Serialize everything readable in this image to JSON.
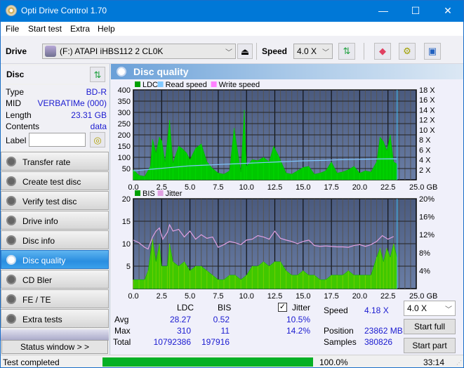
{
  "window": {
    "title": "Opti Drive Control 1.70",
    "minimize": "—",
    "maximize": "☐",
    "close": "✕"
  },
  "menu": [
    "File",
    "Start test",
    "Extra",
    "Help"
  ],
  "toolbar": {
    "drive_label": "Drive",
    "drive_value": "(F:)  ATAPI iHBS112  2 CL0K",
    "speed_label": "Speed",
    "speed_value": "4.0 X",
    "icons": [
      "drive-icon",
      "eject-icon",
      "refresh-icon",
      "eraser-icon",
      "settings-icon",
      "save-icon"
    ]
  },
  "sidebar": {
    "disc_header": "Disc",
    "info": [
      {
        "key": "Type",
        "value": "BD-R"
      },
      {
        "key": "MID",
        "value": "VERBATIMe (000)"
      },
      {
        "key": "Length",
        "value": "23.31 GB"
      },
      {
        "key": "Contents",
        "value": "data"
      }
    ],
    "label_key": "Label",
    "label_value": "",
    "nav": [
      {
        "label": "Transfer rate",
        "active": false
      },
      {
        "label": "Create test disc",
        "active": false
      },
      {
        "label": "Verify test disc",
        "active": false
      },
      {
        "label": "Drive info",
        "active": false
      },
      {
        "label": "Disc info",
        "active": false
      },
      {
        "label": "Disc quality",
        "active": true
      },
      {
        "label": "CD Bler",
        "active": false
      },
      {
        "label": "FE / TE",
        "active": false
      },
      {
        "label": "Extra tests",
        "active": false
      }
    ],
    "status_window": "Status window > >"
  },
  "panel": {
    "title": "Disc quality"
  },
  "chart_data": [
    {
      "type": "area",
      "title": "",
      "legend": [
        "LDC",
        "Read speed",
        "Write speed"
      ],
      "legend_colors": [
        "#00a000",
        "#80c8ff",
        "#ff80ff"
      ],
      "legend_placement": "top-left",
      "xlabel": "GB",
      "x_ticks": [
        "0.0",
        "2.5",
        "5.0",
        "7.5",
        "10.0",
        "12.5",
        "15.0",
        "17.5",
        "20.0",
        "22.5",
        "25.0 GB"
      ],
      "xlim": [
        0,
        25
      ],
      "y_ticks": [
        "50",
        "100",
        "150",
        "200",
        "250",
        "300",
        "350",
        "400"
      ],
      "ylim": [
        0,
        400
      ],
      "y2_ticks": [
        "2 X",
        "4 X",
        "6 X",
        "8 X",
        "10 X",
        "12 X",
        "14 X",
        "16 X",
        "18 X"
      ],
      "y2lim": [
        0,
        18
      ],
      "grid": true,
      "end_position_gb": 23.31,
      "series": [
        {
          "name": "LDC",
          "x": [
            0,
            0.5,
            1.0,
            1.5,
            1.7,
            2.0,
            2.3,
            2.5,
            2.8,
            3.2,
            3.5,
            4.0,
            4.3,
            4.7,
            5.0,
            5.5,
            6.0,
            6.5,
            7.0,
            7.5,
            8.0,
            8.5,
            8.9,
            9.5,
            9.8,
            10.0,
            10.5,
            11.0,
            11.5,
            12.0,
            12.4,
            12.8,
            13.5,
            14.0,
            14.5,
            15.0,
            15.5,
            16.0,
            16.5,
            17.0,
            17.5,
            18.0,
            18.5,
            19.0,
            19.5,
            20.0,
            20.5,
            21.0,
            21.5,
            21.8,
            22.1,
            22.4,
            22.7,
            23.0,
            23.3
          ],
          "values": [
            45,
            20,
            15,
            60,
            180,
            120,
            190,
            175,
            80,
            265,
            75,
            150,
            140,
            120,
            90,
            140,
            160,
            80,
            50,
            30,
            25,
            40,
            230,
            35,
            310,
            60,
            90,
            85,
            100,
            80,
            150,
            110,
            30,
            25,
            40,
            55,
            60,
            25,
            30,
            40,
            80,
            30,
            35,
            45,
            60,
            30,
            40,
            35,
            80,
            190,
            170,
            130,
            200,
            80,
            70
          ]
        },
        {
          "name": "Read speed",
          "x": [
            0,
            1,
            2,
            3,
            4,
            5,
            6,
            7,
            8,
            9,
            10,
            11,
            12,
            13,
            14,
            15,
            16,
            17,
            18,
            19,
            20,
            21,
            22,
            23,
            23.31
          ],
          "values": [
            1.8,
            2.0,
            2.2,
            2.4,
            2.6,
            2.8,
            2.9,
            3.0,
            3.1,
            3.2,
            3.3,
            3.4,
            3.5,
            3.6,
            3.7,
            3.8,
            3.85,
            3.9,
            4.0,
            4.05,
            4.1,
            4.15,
            4.18,
            4.2,
            4.18
          ]
        }
      ]
    },
    {
      "type": "area",
      "title": "",
      "legend": [
        "BIS",
        "Jitter"
      ],
      "legend_colors": [
        "#00a000",
        "#e0a0e0"
      ],
      "legend_placement": "top-left",
      "xlabel": "GB",
      "x_ticks": [
        "0.0",
        "2.5",
        "5.0",
        "7.5",
        "10.0",
        "12.5",
        "15.0",
        "17.5",
        "20.0",
        "22.5",
        "25.0 GB"
      ],
      "xlim": [
        0,
        25
      ],
      "y_ticks": [
        "5",
        "10",
        "15",
        "20"
      ],
      "ylim": [
        0,
        20
      ],
      "y2_ticks": [
        "4%",
        "8%",
        "12%",
        "16%",
        "20%"
      ],
      "y2lim": [
        0,
        20
      ],
      "grid": true,
      "end_position_gb": 23.31,
      "series": [
        {
          "name": "BIS",
          "x": [
            0,
            0.5,
            1.0,
            1.3,
            1.7,
            2.0,
            2.3,
            2.5,
            3.0,
            3.2,
            3.5,
            4.0,
            4.5,
            5.0,
            5.5,
            6.0,
            6.5,
            7.0,
            7.5,
            8.0,
            8.5,
            9.0,
            9.5,
            10.0,
            10.5,
            11.0,
            11.5,
            12.0,
            12.5,
            13.0,
            13.5,
            14.0,
            14.5,
            15.0,
            15.5,
            16.0,
            16.5,
            17.0,
            17.5,
            18.0,
            18.5,
            19.0,
            19.5,
            20.0,
            20.5,
            21.0,
            21.5,
            21.8,
            22.1,
            22.4,
            22.7,
            23.0,
            23.3
          ],
          "values": [
            2,
            2,
            2,
            4,
            11,
            6,
            10,
            5,
            5,
            10,
            6,
            5,
            6,
            4,
            5,
            5,
            4,
            3,
            2,
            2,
            3,
            3,
            2,
            3,
            5,
            5,
            6,
            5,
            6,
            6,
            4,
            3,
            3,
            4,
            3,
            3,
            2,
            2,
            3,
            3,
            3,
            4,
            3,
            3,
            3,
            3,
            7,
            9,
            6,
            9,
            7,
            10,
            7
          ]
        },
        {
          "name": "Jitter",
          "x": [
            0,
            0.5,
            1.0,
            1.3,
            1.7,
            2.0,
            2.3,
            2.6,
            3.0,
            3.2,
            3.5,
            4.0,
            4.5,
            5.0,
            5.5,
            6.0,
            6.5,
            7.0,
            7.5,
            8.0,
            8.5,
            9.0,
            9.5,
            10.0,
            10.5,
            11.0,
            11.5,
            12.0,
            12.5,
            13.0,
            13.5,
            14.0,
            14.5,
            15.0,
            15.5,
            16.0,
            16.5,
            17.0,
            17.5,
            18.0,
            18.5,
            19.0,
            19.5,
            20.0,
            20.5,
            21.0,
            21.5,
            22.0,
            22.5,
            23.0
          ],
          "values": [
            10.8,
            10.2,
            9.2,
            8.8,
            11.5,
            12.8,
            13.5,
            11.0,
            12.5,
            14.2,
            12.8,
            13.2,
            11.5,
            12.8,
            11.0,
            12.0,
            11.2,
            11.5,
            9.2,
            9.8,
            10.5,
            10.2,
            9.8,
            10.8,
            11.0,
            11.8,
            11.5,
            11.0,
            12.8,
            11.2,
            10.8,
            10.5,
            10.0,
            10.5,
            10.8,
            9.6,
            9.4,
            9.5,
            9.4,
            9.3,
            9.3,
            9.2,
            9.6,
            9.8,
            9.4,
            9.8,
            10.5,
            11.8,
            11.0,
            11.6
          ]
        }
      ]
    }
  ],
  "stats": {
    "headers": {
      "ldc": "LDC",
      "bis": "BIS",
      "jitter": "Jitter"
    },
    "jitter_checked": true,
    "rows": [
      {
        "label": "Avg",
        "ldc": "28.27",
        "bis": "0.52",
        "jitter": "10.5%"
      },
      {
        "label": "Max",
        "ldc": "310",
        "bis": "11",
        "jitter": "14.2%"
      },
      {
        "label": "Total",
        "ldc": "10792386",
        "bis": "197916",
        "jitter": ""
      }
    ],
    "speed_label": "Speed",
    "speed_value": "4.18 X",
    "position_label": "Position",
    "position_value": "23862 MB",
    "samples_label": "Samples",
    "samples_value": "380826",
    "speed_select": "4.0 X",
    "start_full": "Start full",
    "start_part": "Start part"
  },
  "statusbar": {
    "text": "Test completed",
    "progress_percent": 100.0,
    "progress_text": "100.0%",
    "time": "33:14"
  }
}
